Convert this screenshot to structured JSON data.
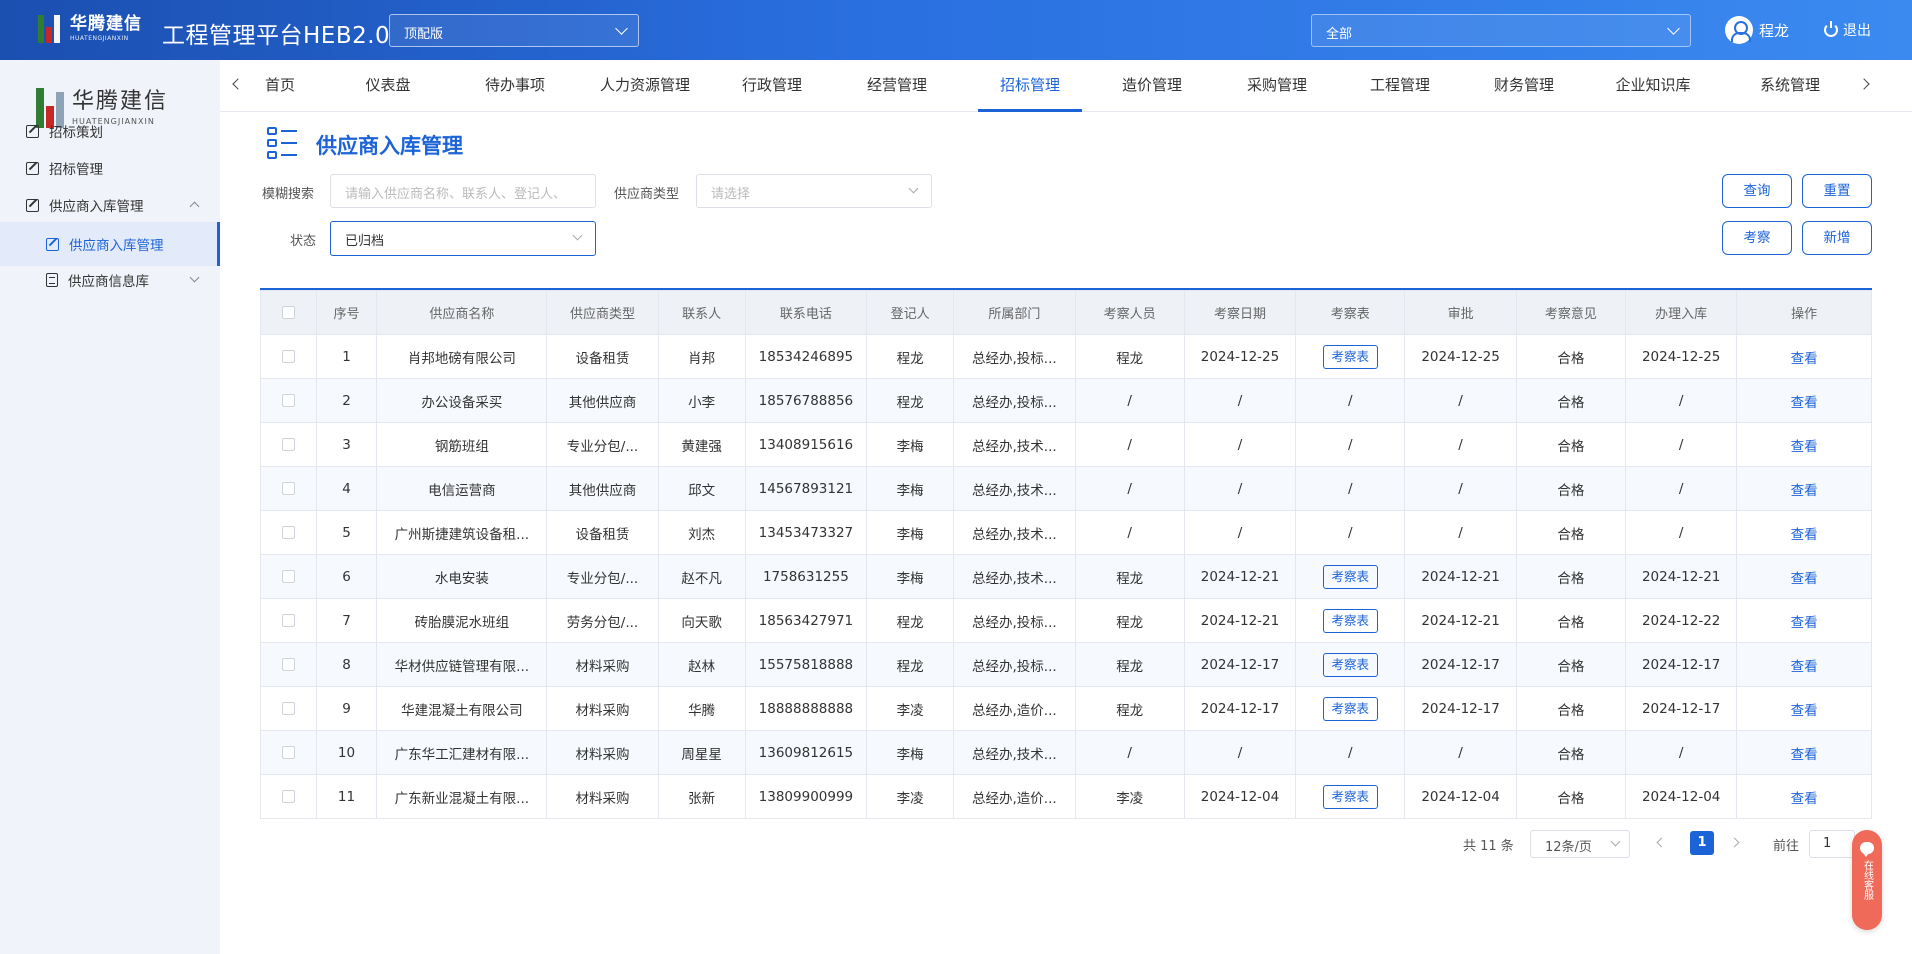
{
  "header": {
    "logo_cn": "华腾建信",
    "logo_en": "HUATENGJIANXIN",
    "app_title": "工程管理平台HEB2.0",
    "edition_value": "顶配版",
    "scope_value": "全部",
    "user_name": "程龙",
    "logout_label": "退出"
  },
  "sidebar": {
    "logo_cn": "华腾建信",
    "logo_en": "HUATENGJIANXIN",
    "items": [
      {
        "label": "招标策划"
      },
      {
        "label": "招标管理"
      },
      {
        "label": "供应商入库管理"
      },
      {
        "label": "供应商入库管理"
      },
      {
        "label": "供应商信息库"
      }
    ]
  },
  "nav": {
    "tabs": [
      {
        "label": "首页"
      },
      {
        "label": "仪表盘"
      },
      {
        "label": "待办事项"
      },
      {
        "label": "人力资源管理"
      },
      {
        "label": "行政管理"
      },
      {
        "label": "经营管理"
      },
      {
        "label": "招标管理"
      },
      {
        "label": "造价管理"
      },
      {
        "label": "采购管理"
      },
      {
        "label": "工程管理"
      },
      {
        "label": "财务管理"
      },
      {
        "label": "企业知识库"
      },
      {
        "label": "系统管理"
      }
    ],
    "active_tab": "招标管理"
  },
  "page": {
    "title": "供应商入库管理"
  },
  "filters": {
    "search_label": "模糊搜索",
    "search_placeholder": "请输入供应商名称、联系人、登记人、",
    "type_label": "供应商类型",
    "type_placeholder": "请选择",
    "status_label": "状态",
    "status_value": "已归档",
    "query_button": "查询",
    "reset_button": "重置",
    "inspect_button": "考察",
    "add_button": "新增"
  },
  "table": {
    "columns": [
      "序号",
      "供应商名称",
      "供应商类型",
      "联系人",
      "联系电话",
      "登记人",
      "所属部门",
      "考察人员",
      "考察日期",
      "考察表",
      "审批",
      "考察意见",
      "办理入库",
      "操作"
    ],
    "inspect_sheet_label": "考察表",
    "view_label": "查看",
    "rows": [
      {
        "no": "1",
        "name": "肖邦地磅有限公司",
        "type": "设备租赁",
        "contact": "肖邦",
        "phone": "18534246895",
        "registrar": "程龙",
        "dept": "总经办,投标...",
        "inspector": "程龙",
        "inspect_date": "2024-12-25",
        "has_sheet": true,
        "approval": "2024-12-25",
        "opinion": "合格",
        "storage": "2024-12-25"
      },
      {
        "no": "2",
        "name": "办公设备采买",
        "type": "其他供应商",
        "contact": "小李",
        "phone": "18576788856",
        "registrar": "程龙",
        "dept": "总经办,投标...",
        "inspector": "/",
        "inspect_date": "/",
        "has_sheet": false,
        "approval": "/",
        "opinion": "合格",
        "storage": "/"
      },
      {
        "no": "3",
        "name": "钢筋班组",
        "type": "专业分包/...",
        "contact": "黄建强",
        "phone": "13408915616",
        "registrar": "李梅",
        "dept": "总经办,技术...",
        "inspector": "/",
        "inspect_date": "/",
        "has_sheet": false,
        "approval": "/",
        "opinion": "合格",
        "storage": "/"
      },
      {
        "no": "4",
        "name": "电信运营商",
        "type": "其他供应商",
        "contact": "邱文",
        "phone": "14567893121",
        "registrar": "李梅",
        "dept": "总经办,技术...",
        "inspector": "/",
        "inspect_date": "/",
        "has_sheet": false,
        "approval": "/",
        "opinion": "合格",
        "storage": "/"
      },
      {
        "no": "5",
        "name": "广州斯捷建筑设备租...",
        "type": "设备租赁",
        "contact": "刘杰",
        "phone": "13453473327",
        "registrar": "李梅",
        "dept": "总经办,技术...",
        "inspector": "/",
        "inspect_date": "/",
        "has_sheet": false,
        "approval": "/",
        "opinion": "合格",
        "storage": "/"
      },
      {
        "no": "6",
        "name": "水电安装",
        "type": "专业分包/...",
        "contact": "赵不凡",
        "phone": "1758631255",
        "registrar": "李梅",
        "dept": "总经办,技术...",
        "inspector": "程龙",
        "inspect_date": "2024-12-21",
        "has_sheet": true,
        "approval": "2024-12-21",
        "opinion": "合格",
        "storage": "2024-12-21"
      },
      {
        "no": "7",
        "name": "砖胎膜泥水班组",
        "type": "劳务分包/...",
        "contact": "向天歌",
        "phone": "18563427971",
        "registrar": "程龙",
        "dept": "总经办,投标...",
        "inspector": "程龙",
        "inspect_date": "2024-12-21",
        "has_sheet": true,
        "approval": "2024-12-21",
        "opinion": "合格",
        "storage": "2024-12-22"
      },
      {
        "no": "8",
        "name": "华材供应链管理有限...",
        "type": "材料采购",
        "contact": "赵林",
        "phone": "15575818888",
        "registrar": "程龙",
        "dept": "总经办,投标...",
        "inspector": "程龙",
        "inspect_date": "2024-12-17",
        "has_sheet": true,
        "approval": "2024-12-17",
        "opinion": "合格",
        "storage": "2024-12-17"
      },
      {
        "no": "9",
        "name": "华建混凝土有限公司",
        "type": "材料采购",
        "contact": "华腾",
        "phone": "18888888888",
        "registrar": "李凌",
        "dept": "总经办,造价...",
        "inspector": "程龙",
        "inspect_date": "2024-12-17",
        "has_sheet": true,
        "approval": "2024-12-17",
        "opinion": "合格",
        "storage": "2024-12-17"
      },
      {
        "no": "10",
        "name": "广东华工汇建材有限...",
        "type": "材料采购",
        "contact": "周星星",
        "phone": "13609812615",
        "registrar": "李梅",
        "dept": "总经办,技术...",
        "inspector": "/",
        "inspect_date": "/",
        "has_sheet": false,
        "approval": "/",
        "opinion": "合格",
        "storage": "/"
      },
      {
        "no": "11",
        "name": "广东新业混凝土有限...",
        "type": "材料采购",
        "contact": "张新",
        "phone": "13809900999",
        "registrar": "李凌",
        "dept": "总经办,造价...",
        "inspector": "李凌",
        "inspect_date": "2024-12-04",
        "has_sheet": true,
        "approval": "2024-12-04",
        "opinion": "合格",
        "storage": "2024-12-04"
      }
    ]
  },
  "pagination": {
    "total_text": "共 11 条",
    "page_size": "12条/页",
    "current_page": "1",
    "goto_label": "前往",
    "goto_value": "1"
  },
  "chat": {
    "label": "在线客服"
  },
  "colors": {
    "accent": "#1d63d8",
    "topbar_start": "#1b4fb0",
    "topbar_end": "#3a8af0",
    "sidebar_bg": "#f0f3f9",
    "chat_float": "#f06a5a"
  }
}
